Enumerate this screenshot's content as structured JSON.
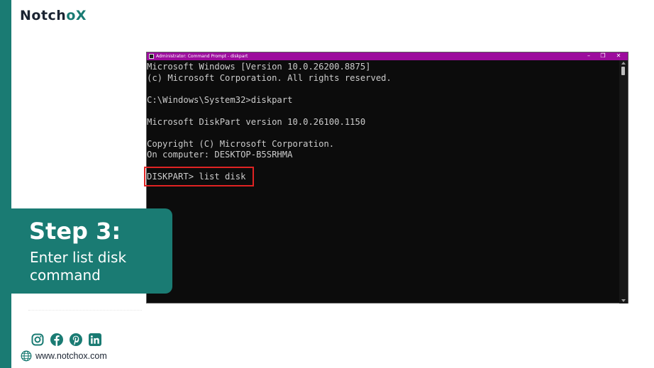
{
  "brand": {
    "logo_prefix": "Notch",
    "logo_o": "o",
    "logo_suffix": "X",
    "accent_color": "#1a7b73"
  },
  "window": {
    "title": "Administrator: Command Prompt - diskpart",
    "titlebar_color": "#9c0c9d",
    "controls": {
      "minimize": "–",
      "maximize": "❐",
      "close": "✕"
    }
  },
  "console": {
    "lines": [
      "Microsoft Windows [Version 10.0.26200.8875]",
      "(c) Microsoft Corporation. All rights reserved.",
      "",
      "C:\\Windows\\System32>diskpart",
      "",
      "Microsoft DiskPart version 10.0.26100.1150",
      "",
      "Copyright (C) Microsoft Corporation.",
      "On computer: DESKTOP-B5SRHMA",
      "",
      "DISKPART> list disk"
    ],
    "highlight_color": "#e02323"
  },
  "step": {
    "title": "Step 3:",
    "description": "Enter list disk command"
  },
  "social": {
    "icons": [
      "instagram-icon",
      "facebook-icon",
      "pinterest-icon",
      "linkedin-icon"
    ]
  },
  "footer": {
    "website": "www.notchox.com"
  }
}
